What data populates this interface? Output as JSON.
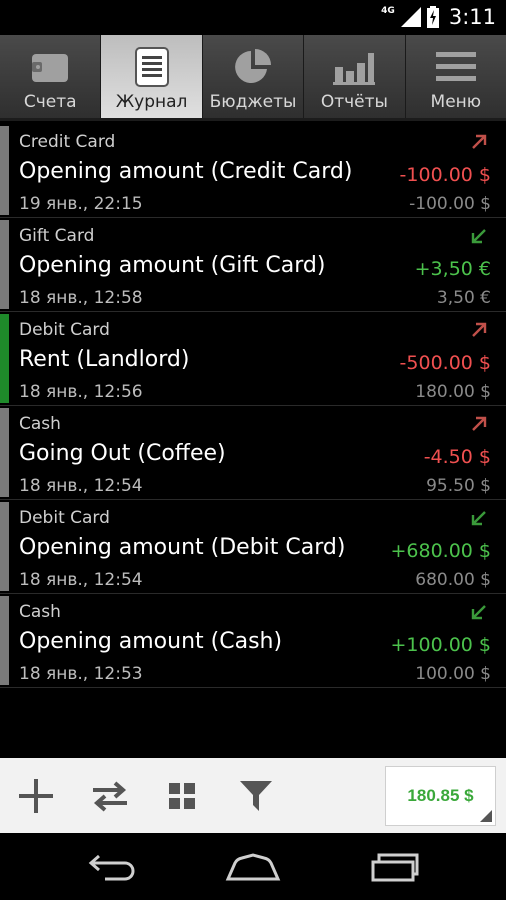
{
  "status_bar": {
    "network": "4G",
    "time": "3:11"
  },
  "tabs": [
    {
      "label": "Счета",
      "icon": "wallet-icon",
      "active": false
    },
    {
      "label": "Журнал",
      "icon": "journal-icon",
      "active": true
    },
    {
      "label": "Бюджеты",
      "icon": "pie-chart-icon",
      "active": false
    },
    {
      "label": "Отчёты",
      "icon": "bar-chart-icon",
      "active": false
    },
    {
      "label": "Меню",
      "icon": "menu-icon",
      "active": false
    }
  ],
  "transactions": [
    {
      "account": "Credit Card",
      "title": "Opening amount (Credit Card)",
      "date": "19 янв., 22:15",
      "amount": "-100.00 $",
      "balance": "-100.00 $",
      "direction": "expense"
    },
    {
      "account": "Gift Card",
      "title": "Opening amount (Gift Card)",
      "date": "18 янв., 12:58",
      "amount": "+3,50 €",
      "balance": "3,50 €",
      "direction": "income"
    },
    {
      "account": "Debit Card",
      "title": "Rent (Landlord)",
      "date": "18 янв., 12:56",
      "amount": "-500.00 $",
      "balance": "180.00 $",
      "direction": "expense"
    },
    {
      "account": "Cash",
      "title": "Going Out (Coffee)",
      "date": "18 янв., 12:54",
      "amount": "-4.50 $",
      "balance": "95.50 $",
      "direction": "expense"
    },
    {
      "account": "Debit Card",
      "title": "Opening amount (Debit Card)",
      "date": "18 янв., 12:54",
      "amount": "+680.00 $",
      "balance": "680.00 $",
      "direction": "income"
    },
    {
      "account": "Cash",
      "title": "Opening amount (Cash)",
      "date": "18 янв., 12:53",
      "amount": "+100.00 $",
      "balance": "100.00 $",
      "direction": "income"
    }
  ],
  "toolbar": {
    "buttons": [
      "add-icon",
      "transfer-icon",
      "grid-icon",
      "filter-icon"
    ],
    "total": "180.85 $"
  },
  "nav": [
    "back-icon",
    "home-icon",
    "recents-icon"
  ],
  "colors": {
    "expense": "#f05050",
    "income": "#4cc24c",
    "expense_arrow": "#c0504a",
    "income_arrow": "#3a9a3a"
  }
}
